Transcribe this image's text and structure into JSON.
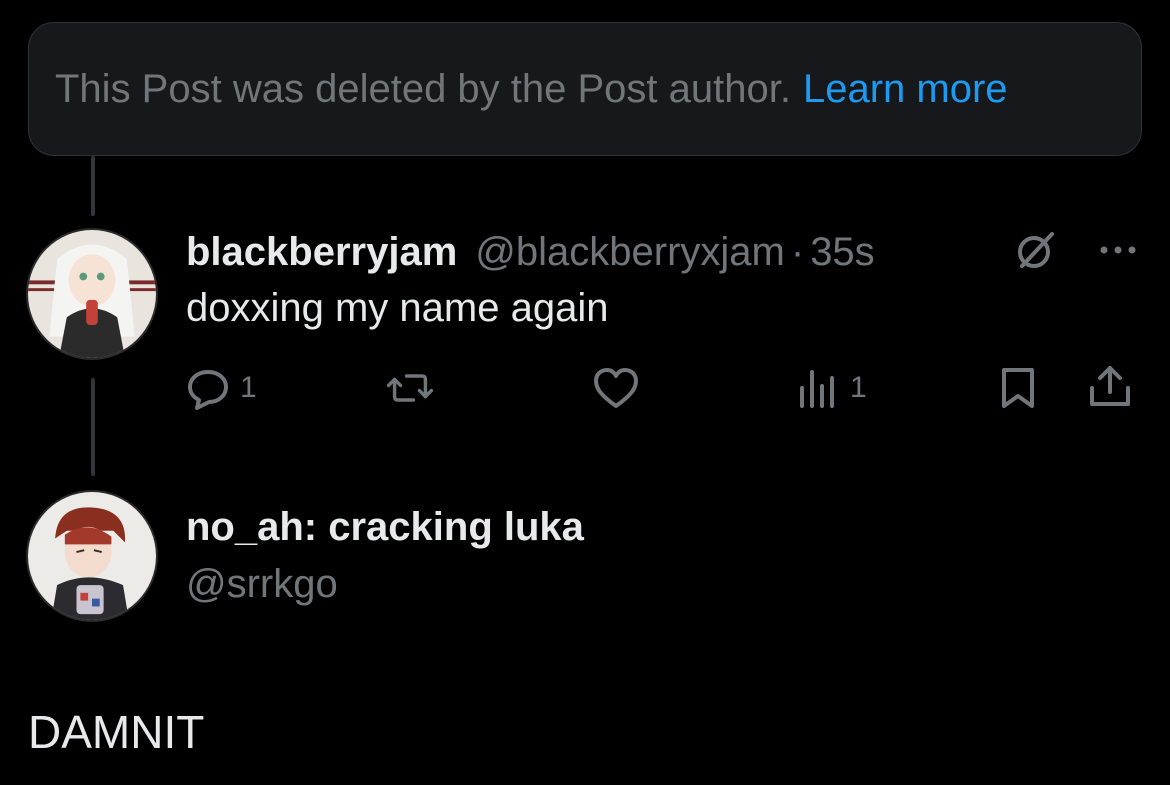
{
  "deleted_notice": {
    "text": "This Post was deleted by the Post author.",
    "link_label": "Learn more"
  },
  "post": {
    "display_name": "blackberryjam",
    "handle": "@blackberryxjam",
    "separator": "·",
    "time": "35s",
    "text": "doxxing my name again",
    "actions": {
      "reply_count": "1",
      "repost_count": "",
      "like_count": "",
      "views_count": "1"
    },
    "icons": [
      "no-sign-icon",
      "more-icon",
      "reply-icon",
      "repost-icon",
      "like-icon",
      "views-icon",
      "bookmark-icon",
      "share-icon"
    ]
  },
  "reply_author": {
    "display_name": "no_ah: cracking luka",
    "handle": "@srrkgo"
  },
  "reply_text": "DAMNIT",
  "colors": {
    "background": "#000000",
    "primary_text": "#e7e9ea",
    "secondary_text": "#71767b",
    "link": "#1d9bf0",
    "notice_bg": "#16181c"
  }
}
